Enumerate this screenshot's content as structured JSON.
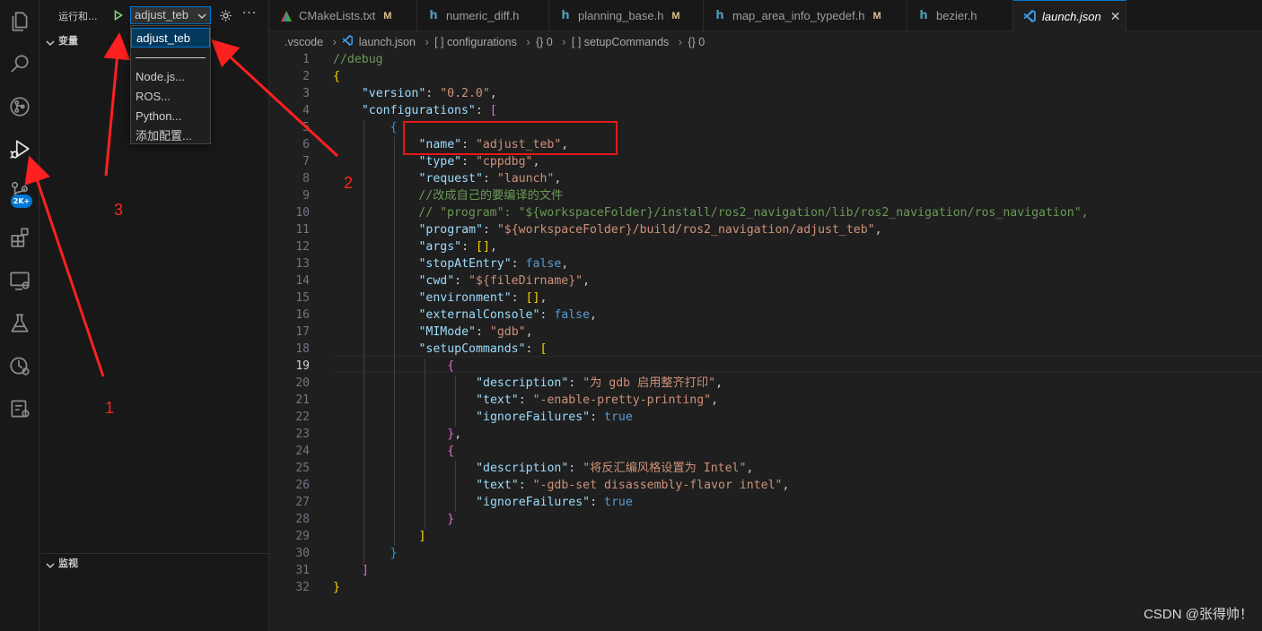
{
  "sidebar": {
    "run_title": "运行和...",
    "selected_config": "adjust_teb",
    "more_glyph": "···",
    "dropdown_items": [
      "adjust_teb",
      "Node.js...",
      "ROS...",
      "Python...",
      "添加配置..."
    ],
    "variables_header": "变量",
    "watch_header": "监视"
  },
  "activity_bar": {
    "icons": [
      "explorer-icon",
      "search-icon",
      "source-control-icon",
      "run-debug-icon",
      "git-graph-icon",
      "extensions-icon",
      "remote-explorer-icon",
      "testing-icon",
      "git-history-icon",
      "cmake-icon"
    ],
    "badge": "2K+"
  },
  "tabs": [
    {
      "label": "CMakeLists.txt",
      "icon": "cmake-icon",
      "modified": "M"
    },
    {
      "label": "numeric_diff.h",
      "icon": "h",
      "modified": ""
    },
    {
      "label": "planning_base.h",
      "icon": "h",
      "modified": "M"
    },
    {
      "label": "map_area_info_typedef.h",
      "icon": "h",
      "modified": "M"
    },
    {
      "label": "bezier.h",
      "icon": "h",
      "modified": ""
    },
    {
      "label": "launch.json",
      "icon": "vscode-icon",
      "modified": "",
      "close": "✕"
    }
  ],
  "breadcrumb": {
    "items": [
      ".vscode",
      "launch.json",
      "[ ] configurations",
      "{} 0",
      "[ ] setupCommands",
      "{} 0"
    ],
    "separator": "›"
  },
  "editor": {
    "current_line": 19,
    "lines": [
      "//debug",
      "{",
      "    \"version\": \"0.2.0\",",
      "    \"configurations\": [",
      "        {",
      "            \"name\": \"adjust_teb\",",
      "            \"type\": \"cppdbg\",",
      "            \"request\": \"launch\",",
      "            //改成自己的要编译的文件",
      "            // \"program\": \"${workspaceFolder}/install/ros2_navigation/lib/ros2_navigation/ros_navigation\",",
      "            \"program\": \"${workspaceFolder}/build/ros2_navigation/adjust_teb\",",
      "            \"args\": [],",
      "            \"stopAtEntry\": false,",
      "            \"cwd\": \"${fileDirname}\",",
      "            \"environment\": [],",
      "            \"externalConsole\": false,",
      "            \"MIMode\": \"gdb\",",
      "            \"setupCommands\": [",
      "                {",
      "                    \"description\": \"为 gdb 启用整齐打印\",",
      "                    \"text\": \"-enable-pretty-printing\",",
      "                    \"ignoreFailures\": true",
      "                },",
      "                {",
      "                    \"description\": \"将反汇编风格设置为 Intel\",",
      "                    \"text\": \"-gdb-set disassembly-flavor intel\",",
      "                    \"ignoreFailures\": true",
      "                }",
      "            ]",
      "        }",
      "    ]",
      "}"
    ]
  },
  "annotations": {
    "labels": [
      "1",
      "2",
      "3"
    ],
    "color": "#ff2020"
  },
  "watermark": "CSDN @张得帅！"
}
